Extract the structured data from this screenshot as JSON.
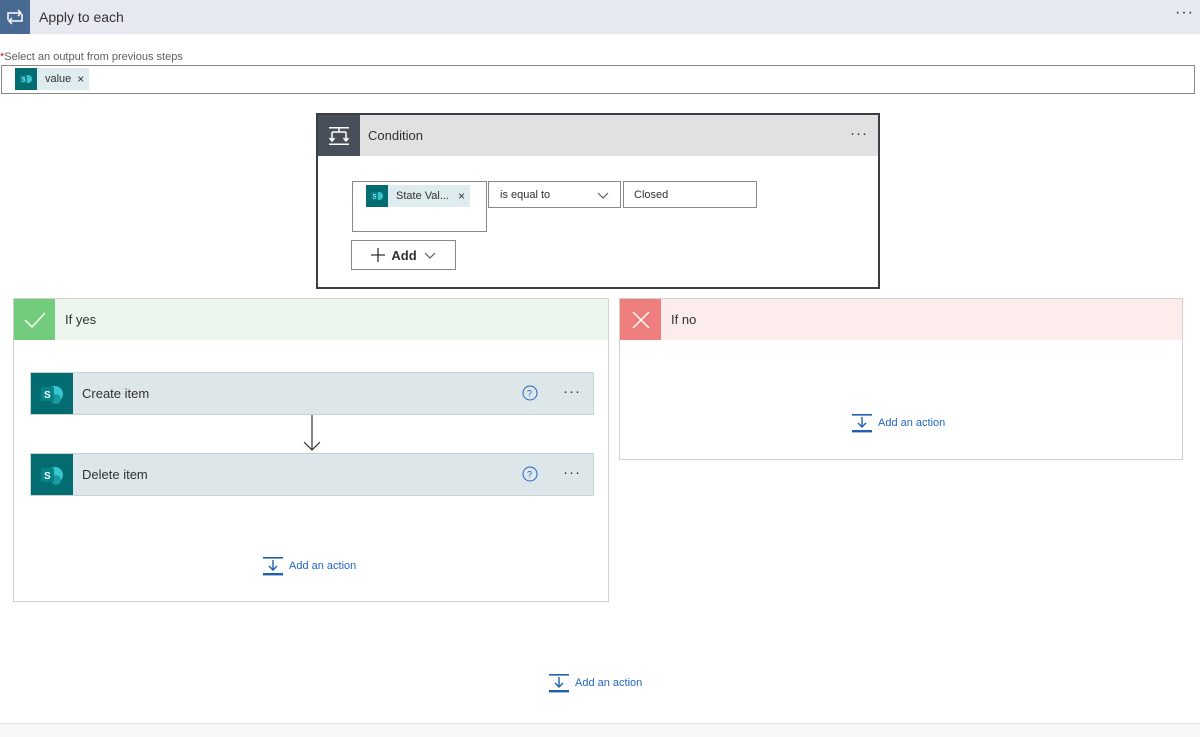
{
  "apply_to_each": {
    "title": "Apply to each",
    "more": "···",
    "select_label": "Select an output from previous steps",
    "required_marker": "*",
    "token_label": "value",
    "token_remove": "×"
  },
  "condition": {
    "title": "Condition",
    "more": "···",
    "left_token": "State Val...",
    "left_token_remove": "×",
    "operator": "is equal to",
    "value": "Closed",
    "add_label": "Add"
  },
  "if_yes": {
    "title": "If yes",
    "actions": [
      {
        "title": "Create item",
        "more": "···"
      },
      {
        "title": "Delete item",
        "more": "···"
      }
    ],
    "add_action": "Add an action"
  },
  "if_no": {
    "title": "If no",
    "add_action": "Add an action"
  },
  "footer": {
    "add_action": "Add an action"
  },
  "colors": {
    "accent_blue": "#486991",
    "sharepoint": "#036c70",
    "yes_green": "#72cc7b",
    "no_red": "#ef7e7e",
    "link_blue": "#2266c0"
  }
}
